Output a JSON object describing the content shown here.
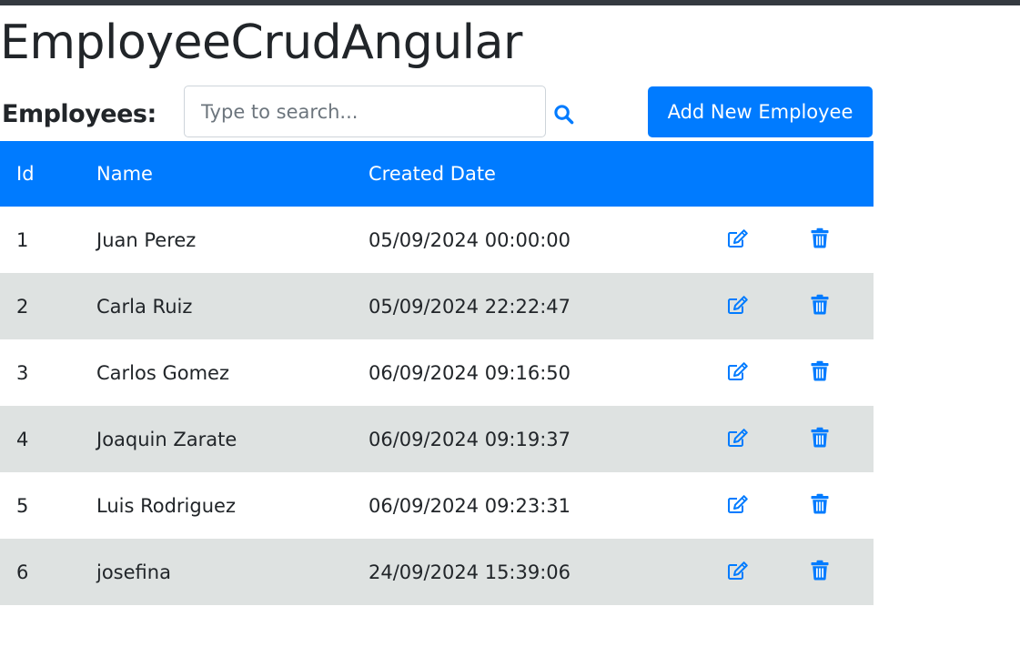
{
  "app": {
    "title": "EmployeeCrudAngular"
  },
  "toolbar": {
    "label": "Employees:",
    "search_placeholder": "Type to search...",
    "search_value": "",
    "search_icon": "search-icon",
    "add_button_label": "Add New Employee"
  },
  "colors": {
    "primary": "#007bff",
    "topbar": "#343a40",
    "stripe": "#dee2e1",
    "text": "#212529"
  },
  "table": {
    "headers": [
      "Id",
      "Name",
      "Created Date",
      "",
      ""
    ],
    "edit_icon": "edit-icon",
    "delete_icon": "trash-icon",
    "rows": [
      {
        "id": "1",
        "name": "Juan Perez",
        "created": "05/09/2024 00:00:00"
      },
      {
        "id": "2",
        "name": "Carla Ruiz",
        "created": "05/09/2024 22:22:47"
      },
      {
        "id": "3",
        "name": "Carlos Gomez",
        "created": "06/09/2024 09:16:50"
      },
      {
        "id": "4",
        "name": "Joaquin Zarate",
        "created": "06/09/2024 09:19:37"
      },
      {
        "id": "5",
        "name": "Luis Rodriguez",
        "created": "06/09/2024 09:23:31"
      },
      {
        "id": "6",
        "name": "josefina",
        "created": "24/09/2024 15:39:06"
      }
    ]
  }
}
